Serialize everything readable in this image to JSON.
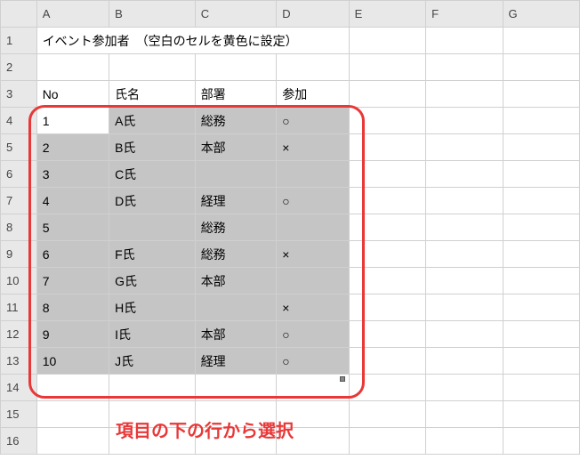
{
  "columns": [
    "A",
    "B",
    "C",
    "D",
    "E",
    "F",
    "G"
  ],
  "rowNumbers": [
    "1",
    "2",
    "3",
    "4",
    "5",
    "6",
    "7",
    "8",
    "9",
    "10",
    "11",
    "12",
    "13",
    "14",
    "15",
    "16"
  ],
  "title": "イベント参加者　（空白のセルを黄色に設定）",
  "headers": {
    "no": "No",
    "name": "氏名",
    "dept": "部署",
    "join": "参加"
  },
  "rows": [
    {
      "no": "1",
      "name": "A氏",
      "dept": "総務",
      "join": "○"
    },
    {
      "no": "2",
      "name": "B氏",
      "dept": "本部",
      "join": "×"
    },
    {
      "no": "3",
      "name": "C氏",
      "dept": "",
      "join": ""
    },
    {
      "no": "4",
      "name": "D氏",
      "dept": "経理",
      "join": "○"
    },
    {
      "no": "5",
      "name": "",
      "dept": "総務",
      "join": ""
    },
    {
      "no": "6",
      "name": "F氏",
      "dept": "総務",
      "join": "×"
    },
    {
      "no": "7",
      "name": "G氏",
      "dept": "本部",
      "join": ""
    },
    {
      "no": "8",
      "name": "H氏",
      "dept": "",
      "join": "×"
    },
    {
      "no": "9",
      "name": "I氏",
      "dept": "本部",
      "join": "○"
    },
    {
      "no": "10",
      "name": "J氏",
      "dept": "経理",
      "join": "○"
    }
  ],
  "annotation": "項目の下の行から選択",
  "chart_data": {
    "type": "table",
    "title": "イベント参加者　（空白のセルを黄色に設定）",
    "columns": [
      "No",
      "氏名",
      "部署",
      "参加"
    ],
    "data": [
      [
        1,
        "A氏",
        "総務",
        "○"
      ],
      [
        2,
        "B氏",
        "本部",
        "×"
      ],
      [
        3,
        "C氏",
        "",
        ""
      ],
      [
        4,
        "D氏",
        "経理",
        "○"
      ],
      [
        5,
        "",
        "総務",
        ""
      ],
      [
        6,
        "F氏",
        "総務",
        "×"
      ],
      [
        7,
        "G氏",
        "本部",
        ""
      ],
      [
        8,
        "H氏",
        "",
        "×"
      ],
      [
        9,
        "I氏",
        "本部",
        "○"
      ],
      [
        10,
        "J氏",
        "経理",
        "○"
      ]
    ]
  }
}
